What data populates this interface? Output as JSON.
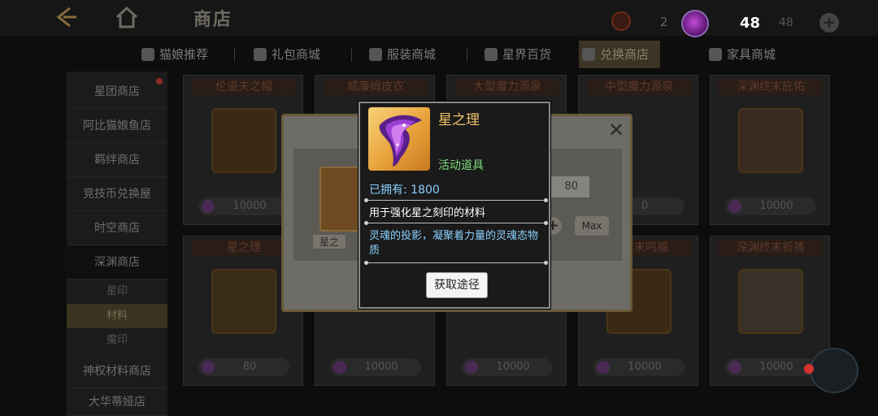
{
  "header": {
    "title": "商店",
    "currency_a_value": "2",
    "currency_b_value": "48",
    "currency_b_secondary": "48",
    "back_icon": "back-arrow-icon",
    "home_icon": "home-icon"
  },
  "tabs": [
    {
      "label": "猫娘推荐",
      "active": false
    },
    {
      "label": "礼包商城",
      "active": false
    },
    {
      "label": "服装商城",
      "active": false
    },
    {
      "label": "星界百货",
      "active": false
    },
    {
      "label": "兑换商店",
      "active": true
    },
    {
      "label": "家具商城",
      "active": false
    }
  ],
  "sidebar": {
    "items": [
      {
        "label": "星团商店"
      },
      {
        "label": "阿比猫娘鱼店"
      },
      {
        "label": "羁绊商店"
      },
      {
        "label": "竞技币兑换屋"
      },
      {
        "label": "时空商店"
      },
      {
        "label": "深渊商店"
      }
    ],
    "subitems": [
      {
        "label": "星印"
      },
      {
        "label": "材料"
      },
      {
        "label": "魔印"
      }
    ],
    "bottom_items": [
      {
        "label": "神权材料商店"
      },
      {
        "label": "大华蒂娅店"
      }
    ]
  },
  "cards": [
    {
      "name": "伦道夫之帽",
      "price": "10000"
    },
    {
      "name": "威廉姆皮衣",
      "price": ""
    },
    {
      "name": "大型魔力源泉",
      "price": ""
    },
    {
      "name": "中型魔力源泉",
      "price": "0"
    },
    {
      "name": "深渊终末庇佑",
      "price": "10000"
    },
    {
      "name": "星之理",
      "price": "80"
    },
    {
      "name": "",
      "price": "10000"
    },
    {
      "name": "",
      "price": "10000"
    },
    {
      "name": "末鸣福",
      "price": "10000"
    },
    {
      "name": "深渊终末祈祷",
      "price": "10000"
    }
  ],
  "buy_dialog": {
    "item_name": "星之",
    "quantity_value": "80",
    "plus_label": "+",
    "max_label": "Max",
    "close_label": "✕"
  },
  "tooltip": {
    "name": "星之理",
    "type": "活动道具",
    "owned": "已拥有: 1800",
    "description": "用于强化星之刻印的材料",
    "flavor": "灵魂的投影，凝聚着力量的灵魂态物质",
    "obtain_button": "获取途径"
  },
  "colors": {
    "tooltip_name": "#f2c46a",
    "tooltip_type": "#7cdf7a",
    "tooltip_info": "#8ad0ff",
    "accent_gold": "#8a6d3a"
  }
}
